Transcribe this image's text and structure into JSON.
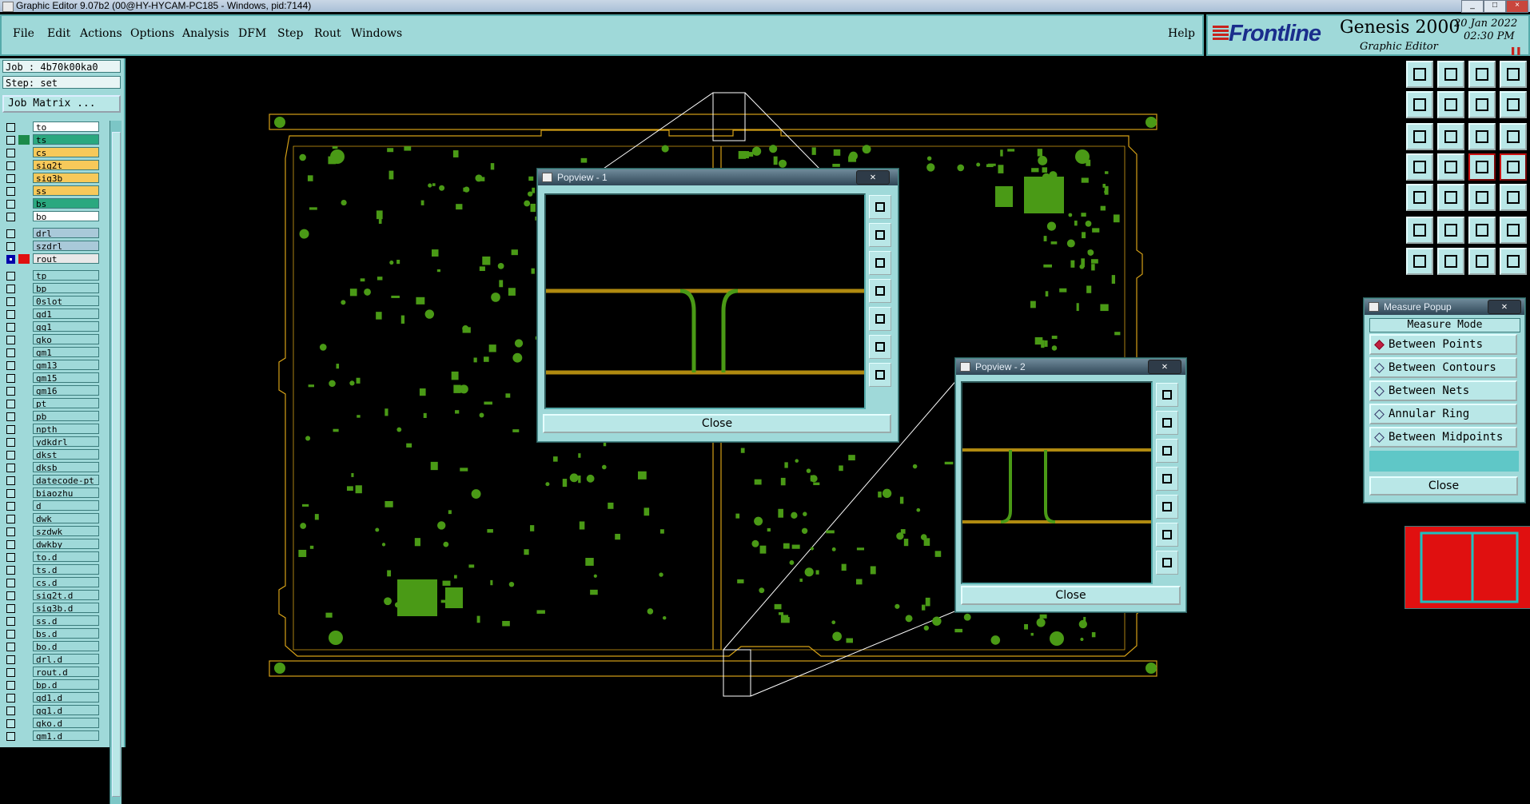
{
  "window": {
    "title": "Graphic Editor 9.07b2 (00@HY-HYCAM-PC185 - Windows, pid:7144)"
  },
  "menu": {
    "items": [
      "File",
      "Edit",
      "Actions",
      "Options",
      "Analysis",
      "DFM",
      "Step",
      "Rout",
      "Windows"
    ],
    "help": "Help"
  },
  "brand": {
    "logo": "Frontline",
    "product": "Genesis 2000",
    "subtitle": "Graphic Editor",
    "date": "20 Jan 2022",
    "time": "02:30 PM"
  },
  "job": {
    "job": "Job : 4b70k00ka0",
    "step": "Step: set",
    "matrix_button": "Job Matrix ..."
  },
  "layers": [
    {
      "name": "to",
      "color": "#ffffff",
      "swatch": ""
    },
    {
      "name": "ts",
      "color": "#2aa87f",
      "swatch": "#1c8a4a"
    },
    {
      "name": "cs",
      "color": "#f7c95a",
      "swatch": ""
    },
    {
      "name": "sig2t",
      "color": "#f7c95a",
      "swatch": ""
    },
    {
      "name": "sig3b",
      "color": "#f7c95a",
      "swatch": ""
    },
    {
      "name": "ss",
      "color": "#f7c95a",
      "swatch": ""
    },
    {
      "name": "bs",
      "color": "#2aa87f",
      "swatch": ""
    },
    {
      "name": "bo",
      "color": "#ffffff",
      "swatch": ""
    },
    {
      "name": "drl",
      "color": "#a9c9d9",
      "swatch": ""
    },
    {
      "name": "szdrl",
      "color": "#a9c9d9",
      "swatch": ""
    },
    {
      "name": "rout",
      "color": "#e8e8e8",
      "swatch": "#e01010",
      "checked": true
    },
    {
      "name": "tp",
      "color": "#9fd9d9",
      "swatch": ""
    },
    {
      "name": "bp",
      "color": "#9fd9d9",
      "swatch": ""
    },
    {
      "name": "0slot",
      "color": "#9fd9d9",
      "swatch": ""
    },
    {
      "name": "gd1",
      "color": "#9fd9d9",
      "swatch": ""
    },
    {
      "name": "gg1",
      "color": "#9fd9d9",
      "swatch": ""
    },
    {
      "name": "gko",
      "color": "#9fd9d9",
      "swatch": ""
    },
    {
      "name": "gm1",
      "color": "#9fd9d9",
      "swatch": ""
    },
    {
      "name": "gm13",
      "color": "#9fd9d9",
      "swatch": ""
    },
    {
      "name": "gm15",
      "color": "#9fd9d9",
      "swatch": ""
    },
    {
      "name": "gm16",
      "color": "#9fd9d9",
      "swatch": ""
    },
    {
      "name": "pt",
      "color": "#9fd9d9",
      "swatch": ""
    },
    {
      "name": "pb",
      "color": "#9fd9d9",
      "swatch": ""
    },
    {
      "name": "npth",
      "color": "#9fd9d9",
      "swatch": ""
    },
    {
      "name": "ydkdrl",
      "color": "#9fd9d9",
      "swatch": ""
    },
    {
      "name": "dkst",
      "color": "#9fd9d9",
      "swatch": ""
    },
    {
      "name": "dksb",
      "color": "#9fd9d9",
      "swatch": ""
    },
    {
      "name": "datecode-pt",
      "color": "#9fd9d9",
      "swatch": ""
    },
    {
      "name": "biaozhu",
      "color": "#9fd9d9",
      "swatch": ""
    },
    {
      "name": "d",
      "color": "#9fd9d9",
      "swatch": ""
    },
    {
      "name": "dwk",
      "color": "#9fd9d9",
      "swatch": ""
    },
    {
      "name": "szdwk",
      "color": "#9fd9d9",
      "swatch": ""
    },
    {
      "name": "dwkby",
      "color": "#9fd9d9",
      "swatch": ""
    },
    {
      "name": "to.d",
      "color": "#9fd9d9",
      "swatch": ""
    },
    {
      "name": "ts.d",
      "color": "#9fd9d9",
      "swatch": ""
    },
    {
      "name": "cs.d",
      "color": "#9fd9d9",
      "swatch": ""
    },
    {
      "name": "sig2t.d",
      "color": "#9fd9d9",
      "swatch": ""
    },
    {
      "name": "sig3b.d",
      "color": "#9fd9d9",
      "swatch": ""
    },
    {
      "name": "ss.d",
      "color": "#9fd9d9",
      "swatch": ""
    },
    {
      "name": "bs.d",
      "color": "#9fd9d9",
      "swatch": ""
    },
    {
      "name": "bo.d",
      "color": "#9fd9d9",
      "swatch": ""
    },
    {
      "name": "drl.d",
      "color": "#9fd9d9",
      "swatch": ""
    },
    {
      "name": "rout.d",
      "color": "#9fd9d9",
      "swatch": ""
    },
    {
      "name": "bp.d",
      "color": "#9fd9d9",
      "swatch": ""
    },
    {
      "name": "gd1.d",
      "color": "#9fd9d9",
      "swatch": ""
    },
    {
      "name": "gg1.d",
      "color": "#9fd9d9",
      "swatch": ""
    },
    {
      "name": "gko.d",
      "color": "#9fd9d9",
      "swatch": ""
    },
    {
      "name": "gm1.d",
      "color": "#9fd9d9",
      "swatch": ""
    }
  ],
  "popview1": {
    "title": "Popview - 1",
    "close": "Close"
  },
  "popview2": {
    "title": "Popview - 2",
    "close": "Close"
  },
  "measure": {
    "title": "Measure Popup",
    "header": "Measure Mode",
    "options": [
      "Between Points",
      "Between Contours",
      "Between Nets",
      "Annular Ring",
      "Between Midpoints"
    ],
    "selected": "Between Points",
    "close": "Close"
  },
  "colors": {
    "board_outline": "#d4a017",
    "copper": "#4a9a16",
    "trace": "#b08a10",
    "panel": "#9fd9d9"
  }
}
